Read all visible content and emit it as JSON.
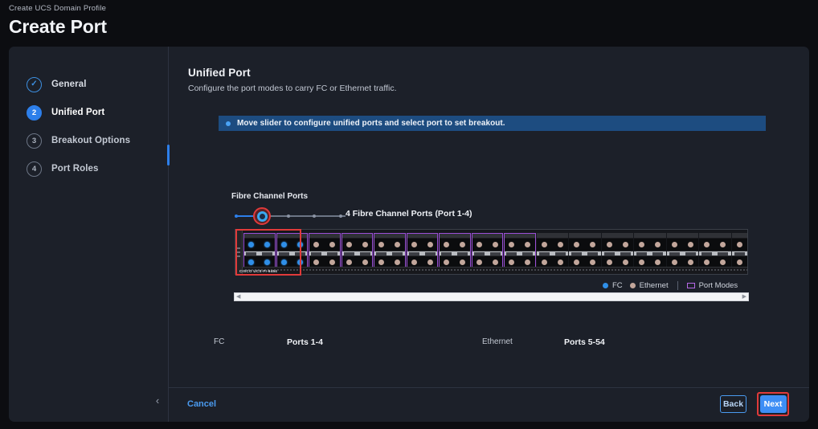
{
  "header": {
    "breadcrumb": "Create UCS Domain Profile",
    "title": "Create Port"
  },
  "sidebar": {
    "steps": [
      {
        "num": "✓",
        "label": "General",
        "state": "done"
      },
      {
        "num": "2",
        "label": "Unified Port",
        "state": "active"
      },
      {
        "num": "3",
        "label": "Breakout Options",
        "state": "todo"
      },
      {
        "num": "4",
        "label": "Port Roles",
        "state": "todo"
      }
    ],
    "collapse_icon": "chevron-left-icon",
    "collapse_glyph": "‹"
  },
  "main": {
    "section_title": "Unified Port",
    "section_subtitle": "Configure the port modes to carry FC or Ethernet traffic.",
    "info_banner": "Move slider to configure unified ports and select port to set breakout.",
    "slider": {
      "label": "Fibre Channel Ports",
      "value_text": "4 Fibre Channel Ports (Port 1-4)",
      "position_index": 0,
      "tick_count": 4
    },
    "legend": [
      {
        "name": "FC",
        "color": "#2f8fe8",
        "shape": "dot"
      },
      {
        "name": "Ethernet",
        "color": "#c2a69b",
        "shape": "dot"
      },
      {
        "name": "Port Modes",
        "color": "#b769e8",
        "shape": "rect"
      }
    ],
    "switch": {
      "model_tag": "CISCO UCS-FI-6454",
      "fc_group_count": 2,
      "mode_group_count": 7,
      "eth_group_count": 9,
      "uplink_group_count": 3,
      "selection_highlight_color": "#e03a3a"
    },
    "scrollbar": {
      "left_arrow": "◀",
      "right_arrow": "▶"
    },
    "mapping": {
      "fc_label": "FC",
      "fc_value": "Ports 1-4",
      "eth_label": "Ethernet",
      "eth_value": "Ports 5-54"
    }
  },
  "footer": {
    "cancel_label": "Cancel",
    "back_label": "Back",
    "next_label": "Next",
    "next_highlight_color": "#e03a3a"
  }
}
